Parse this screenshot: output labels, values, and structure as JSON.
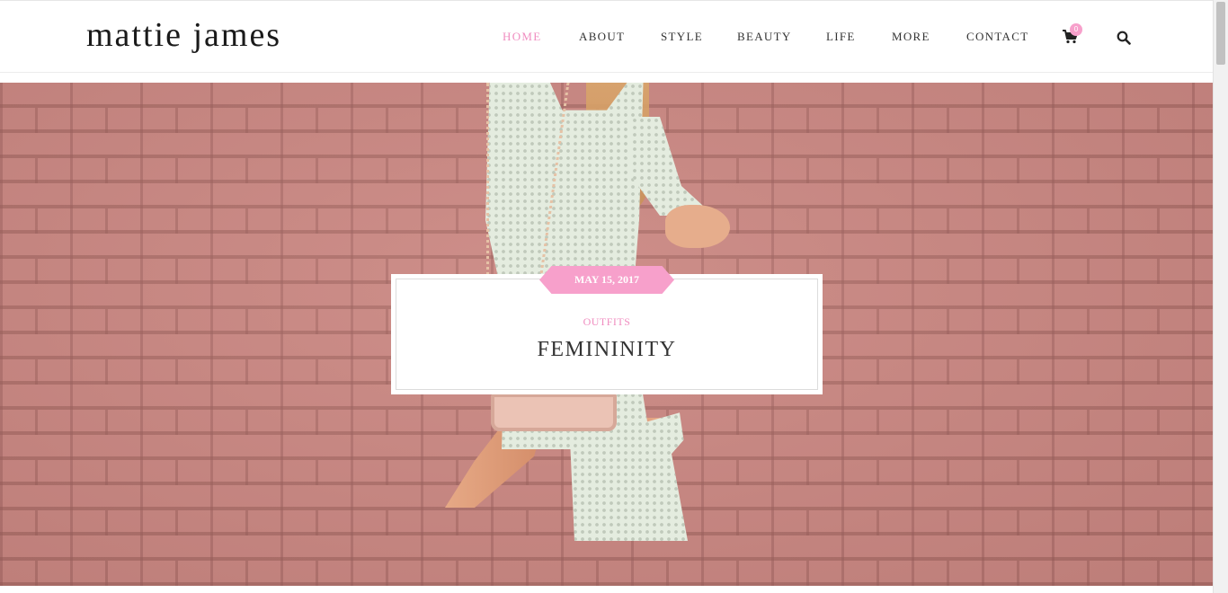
{
  "site": {
    "logo": "mattie james"
  },
  "nav": {
    "items": [
      {
        "label": "HOME",
        "active": true
      },
      {
        "label": "ABOUT",
        "active": false
      },
      {
        "label": "STYLE",
        "active": false
      },
      {
        "label": "BEAUTY",
        "active": false
      },
      {
        "label": "LIFE",
        "active": false
      },
      {
        "label": "MORE",
        "active": false
      },
      {
        "label": "CONTACT",
        "active": false
      }
    ],
    "cart_count": "0",
    "icons": {
      "cart": "shopping-cart-icon",
      "search": "search-icon"
    }
  },
  "featured": {
    "date": "MAY 15, 2017",
    "category": "OUTFITS",
    "title": "FEMININITY"
  },
  "colors": {
    "accent": "#f7a0cb",
    "accent_text": "#f08dc0",
    "brick": "#c7847f"
  }
}
